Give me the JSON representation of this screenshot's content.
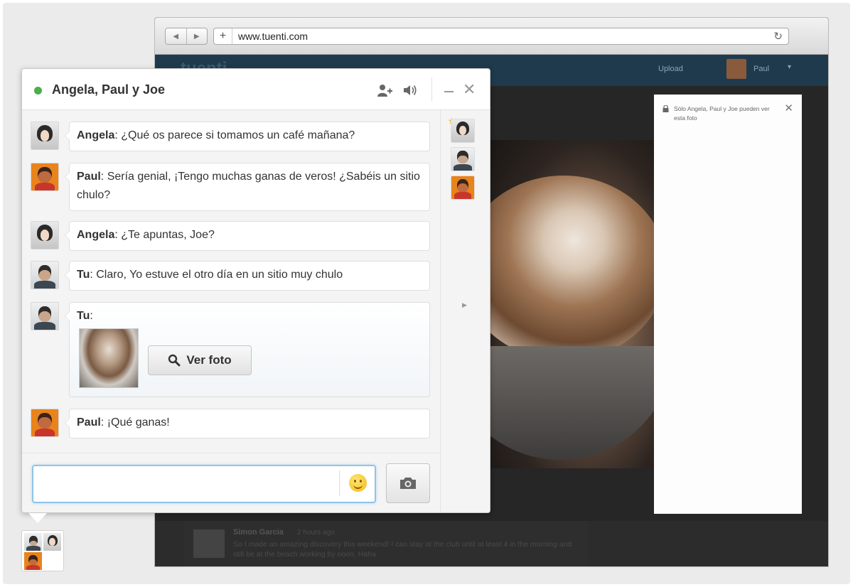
{
  "browser": {
    "url": "www.tuenti.com",
    "back_glyph": "◀",
    "forward_glyph": "▶",
    "new_tab_glyph": "+",
    "reload_glyph": "↻"
  },
  "site": {
    "logo": "tuenti",
    "upload_label": "Upload",
    "user_name": "Paul",
    "caret": "▾"
  },
  "photo_sidebar": {
    "privacy_note": "Sólo Angela, Paul y Joe pueden ver esta foto",
    "close_glyph": "✕"
  },
  "feed": {
    "author": "Simon Garcia",
    "time": "2 hours ago",
    "text": "So I made an amazing discovery this weekend! I can stay at the club until at least 4 in the morning and still be at the beach working by noon. Haha"
  },
  "chat": {
    "title": "Angela, Paul y Joe",
    "status": "online",
    "close_glyph": "✕",
    "icons": {
      "add_user": "add-user-icon",
      "sound": "speaker-icon",
      "minimize": "minimize-icon",
      "close": "close-icon",
      "search": "search-icon",
      "emoji": "smiley-icon",
      "camera": "camera-icon"
    },
    "messages": [
      {
        "sender": "Angela",
        "separator": ": ",
        "text": "¿Qué os parece si tomamos un café mañana?"
      },
      {
        "sender": "Paul",
        "separator": ": ",
        "text": "Sería genial, ¡Tengo muchas ganas de veros! ¿Sabéis un sitio chulo?"
      },
      {
        "sender": "Angela",
        "separator": ": ",
        "text": "¿Te apuntas, Joe?"
      },
      {
        "sender": "Tu",
        "separator": ": ",
        "text": "Claro,  Yo estuve el otro día en un sitio muy chulo"
      },
      {
        "sender": "Tu",
        "separator": ":",
        "text": ""
      },
      {
        "sender": "Paul",
        "separator": ": ",
        "text": "¡Qué ganas!"
      }
    ],
    "view_photo_label": "Ver foto",
    "input_value": "",
    "participant_star": "★"
  },
  "colors": {
    "online": "#4cae4c",
    "input_focus": "#8fc4e8",
    "site_header": "#1f3a4d"
  }
}
